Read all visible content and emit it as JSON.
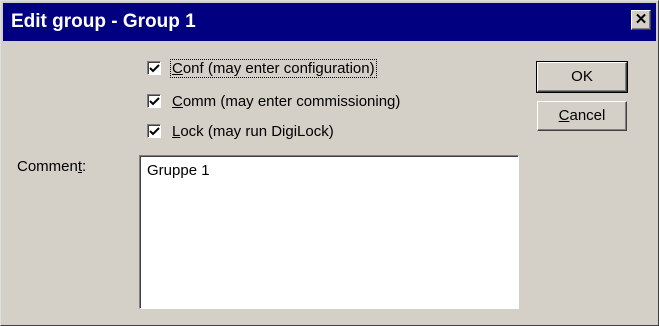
{
  "window": {
    "title": "Edit group - Group 1",
    "close_glyph": "✕"
  },
  "checkboxes": [
    {
      "label_before": "",
      "label_access_key": "C",
      "label_after": "onf (may enter configuration)",
      "checked": true,
      "focused": true
    },
    {
      "label_before": "",
      "label_access_key": "C",
      "label_after": "omm (may enter commissioning)",
      "checked": true,
      "focused": false
    },
    {
      "label_before": "",
      "label_access_key": "L",
      "label_after": "ock (may run DigiLock)",
      "checked": true,
      "focused": false
    }
  ],
  "comment": {
    "label_before": "Commen",
    "label_access_key": "t",
    "label_after": ":",
    "value": "Gruppe 1"
  },
  "buttons": {
    "ok_label": "OK",
    "cancel_before": "",
    "cancel_access_key": "C",
    "cancel_after": "ancel"
  },
  "colors": {
    "titlebar": "#000080",
    "face": "#d4d0c8"
  }
}
